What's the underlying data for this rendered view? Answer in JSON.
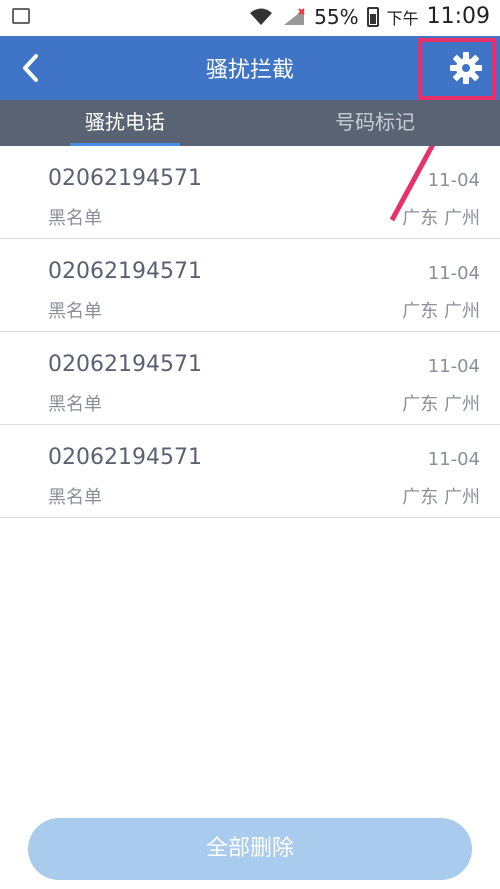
{
  "status_bar": {
    "battery_percent": "55%",
    "ampm": "下午",
    "time": "11:09"
  },
  "header": {
    "title": "骚扰拦截",
    "back_icon": "chevron-left-icon",
    "settings_icon": "gear-icon",
    "accent_color": "#3f74c6",
    "highlight_color": "#e8306a"
  },
  "tabs": [
    {
      "label": "骚扰电话",
      "active": true
    },
    {
      "label": "号码标记",
      "active": false
    }
  ],
  "records": [
    {
      "number": "02062194571",
      "date": "11-04",
      "tag": "黑名单",
      "location": "广东 广州"
    },
    {
      "number": "02062194571",
      "date": "11-04",
      "tag": "黑名单",
      "location": "广东 广州"
    },
    {
      "number": "02062194571",
      "date": "11-04",
      "tag": "黑名单",
      "location": "广东 广州"
    },
    {
      "number": "02062194571",
      "date": "11-04",
      "tag": "黑名单",
      "location": "广东 广州"
    }
  ],
  "footer": {
    "delete_all_label": "全部删除"
  }
}
